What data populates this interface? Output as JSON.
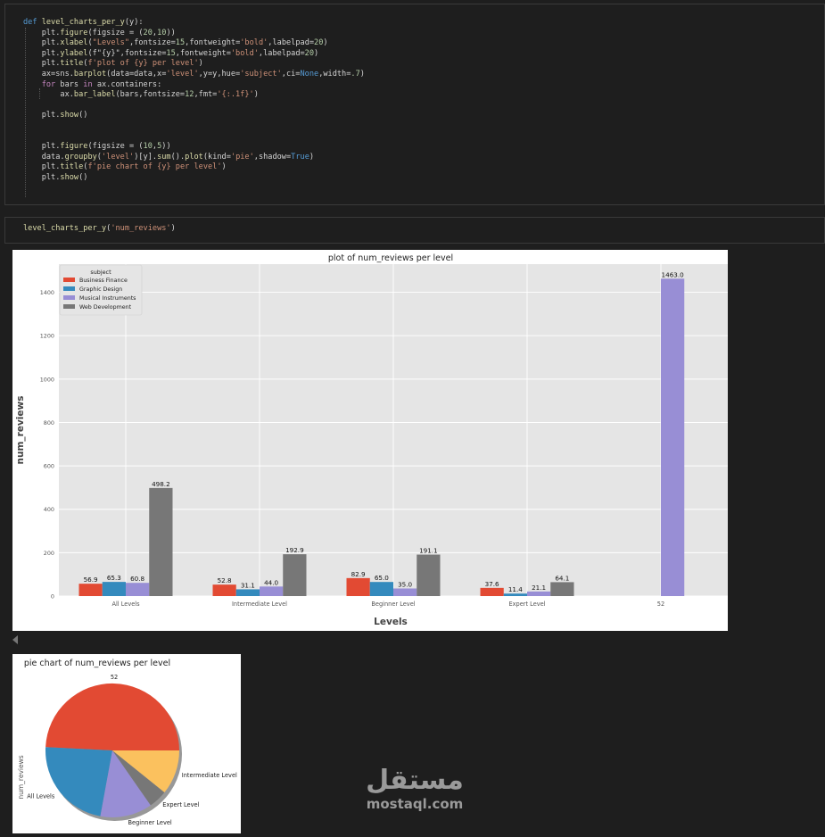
{
  "cells": [
    {
      "code": [
        [
          [
            "def ",
            "kw"
          ],
          [
            "level_charts_per_y",
            "fn"
          ],
          [
            "(y):",
            ""
          ]
        ],
        [
          [
            "    plt.",
            ""
          ],
          [
            "figure",
            "fn"
          ],
          [
            "(figsize = (",
            ""
          ],
          [
            "20",
            "num"
          ],
          [
            ",",
            ""
          ],
          [
            "10",
            "num"
          ],
          [
            "))",
            ""
          ]
        ],
        [
          [
            "    plt.",
            ""
          ],
          [
            "xlabel",
            "fn"
          ],
          [
            "(",
            ""
          ],
          [
            "\"Levels\"",
            "str"
          ],
          [
            ",fontsize=",
            ""
          ],
          [
            "15",
            "num"
          ],
          [
            ",fontweight=",
            ""
          ],
          [
            "'bold'",
            "str"
          ],
          [
            ",labelpad=",
            ""
          ],
          [
            "20",
            "num"
          ],
          [
            ")",
            ""
          ]
        ],
        [
          [
            "    plt.",
            ""
          ],
          [
            "ylabel",
            "fn"
          ],
          [
            "(f\"{y}\"",
            ""
          ],
          [
            ",fontsize=",
            ""
          ],
          [
            "15",
            "num"
          ],
          [
            ",fontweight=",
            ""
          ],
          [
            "'bold'",
            "str"
          ],
          [
            ",labelpad=",
            ""
          ],
          [
            "20",
            "num"
          ],
          [
            ")",
            ""
          ]
        ],
        [
          [
            "    plt.",
            ""
          ],
          [
            "title",
            "fn"
          ],
          [
            "(",
            ""
          ],
          [
            "f'plot of {y} per level'",
            "str"
          ],
          [
            ")",
            ""
          ]
        ],
        [
          [
            "    ax=sns.",
            ""
          ],
          [
            "barplot",
            "fn"
          ],
          [
            "(data=data,x=",
            ""
          ],
          [
            "'level'",
            "str"
          ],
          [
            ",y=y,hue=",
            ""
          ],
          [
            "'subject'",
            "str"
          ],
          [
            ",ci=",
            ""
          ],
          [
            "None",
            "kw"
          ],
          [
            ",width=",
            ""
          ],
          [
            ".7",
            "num"
          ],
          [
            ")",
            ""
          ]
        ],
        [
          [
            "    ",
            ""
          ],
          [
            "for ",
            "ctl"
          ],
          [
            "bars ",
            ""
          ],
          [
            "in ",
            "ctl"
          ],
          [
            "ax.containers:",
            ""
          ]
        ],
        [
          [
            "        ax.",
            ""
          ],
          [
            "bar_label",
            "fn"
          ],
          [
            "(bars,fontsize=",
            ""
          ],
          [
            "12",
            "num"
          ],
          [
            ",fmt=",
            ""
          ],
          [
            "'{:.1f}'",
            "str"
          ],
          [
            ")",
            ""
          ]
        ],
        [
          [
            "    ",
            ""
          ]
        ],
        [
          [
            "    plt.",
            ""
          ],
          [
            "show",
            "fn"
          ],
          [
            "()",
            ""
          ]
        ],
        [
          [
            "    ",
            ""
          ]
        ],
        [
          [
            "",
            ""
          ]
        ],
        [
          [
            "    plt.",
            ""
          ],
          [
            "figure",
            "fn"
          ],
          [
            "(figsize = (",
            ""
          ],
          [
            "10",
            "num"
          ],
          [
            ",",
            ""
          ],
          [
            "5",
            "num"
          ],
          [
            "))",
            ""
          ]
        ],
        [
          [
            "    data.",
            ""
          ],
          [
            "groupby",
            "fn"
          ],
          [
            "(",
            ""
          ],
          [
            "'level'",
            "str"
          ],
          [
            ")[y].",
            ""
          ],
          [
            "sum",
            "fn"
          ],
          [
            "().",
            ""
          ],
          [
            "plot",
            "fn"
          ],
          [
            "(kind=",
            ""
          ],
          [
            "'pie'",
            "str"
          ],
          [
            ",shadow=",
            ""
          ],
          [
            "True",
            "kw"
          ],
          [
            ")",
            ""
          ]
        ],
        [
          [
            "    plt.",
            ""
          ],
          [
            "title",
            "fn"
          ],
          [
            "(",
            ""
          ],
          [
            "f'pie chart of {y} per level'",
            "str"
          ],
          [
            ")",
            ""
          ]
        ],
        [
          [
            "    plt.",
            ""
          ],
          [
            "show",
            "fn"
          ],
          [
            "()",
            ""
          ]
        ]
      ]
    },
    {
      "code": [
        [
          [
            "level_charts_per_y",
            "fn"
          ],
          [
            "(",
            ""
          ],
          [
            "'num_reviews'",
            "str"
          ],
          [
            ")",
            ""
          ]
        ]
      ]
    }
  ],
  "chart_data": [
    {
      "type": "bar",
      "title": "plot of num_reviews per level",
      "xlabel": "Levels",
      "ylabel": "num_reviews",
      "categories": [
        "All Levels",
        "Intermediate Level",
        "Beginner Level",
        "Expert Level",
        "52"
      ],
      "ylim": [
        0,
        1530
      ],
      "yticks": [
        0,
        200,
        400,
        600,
        800,
        1000,
        1200,
        1400
      ],
      "grid": true,
      "legend_title": "subject",
      "legend_position": "top-left",
      "series": [
        {
          "name": "Business Finance",
          "color": "#e24a33",
          "values": [
            56.9,
            52.8,
            82.9,
            37.6,
            null
          ]
        },
        {
          "name": "Graphic Design",
          "color": "#348abd",
          "values": [
            65.3,
            31.1,
            65.0,
            11.4,
            null
          ]
        },
        {
          "name": "Musical Instruments",
          "color": "#988ed5",
          "values": [
            60.8,
            44.0,
            35.0,
            21.1,
            1463.0
          ]
        },
        {
          "name": "Web Development",
          "color": "#777777",
          "values": [
            498.2,
            192.9,
            191.1,
            64.1,
            null
          ]
        }
      ]
    },
    {
      "type": "pie",
      "title": "pie chart of num_reviews per level",
      "ylabel": "num_reviews",
      "shadow": true,
      "labels": [
        "52",
        "All Levels",
        "Beginner Level",
        "Expert Level",
        "Intermediate Level"
      ],
      "values": [
        1463.0,
        681.2,
        374.0,
        134.2,
        320.8
      ],
      "colors": [
        "#e24a33",
        "#348abd",
        "#988ed5",
        "#777777",
        "#fbc15e"
      ]
    }
  ],
  "watermark": {
    "arabic": "مستقل",
    "latin": "mostaql.com"
  }
}
